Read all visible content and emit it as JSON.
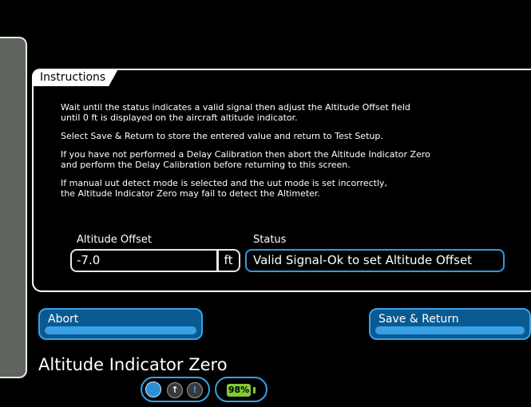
{
  "instructions": {
    "tab_label": "Instructions",
    "paragraphs": [
      "Wait until the status indicates a valid signal then adjust the Altitude Offset field\nuntil 0 ft is displayed on the aircraft altitude indicator.",
      "Select Save & Return to store the entered value and return to Test Setup.",
      "If you have not performed a Delay Calibration then abort the Altitude Indicator Zero\nand perform the Delay Calibration before returning to this screen.",
      "If manual uut detect mode is selected and the uut mode is set incorrectly,\nthe Altitude Indicator Zero may fail to detect the Altimeter."
    ]
  },
  "altitude_offset": {
    "label": "Altitude Offset",
    "value": "-7.0",
    "unit": "ft"
  },
  "status": {
    "label": "Status",
    "value": "Valid Signal-Ok to set Altitude Offset"
  },
  "buttons": {
    "abort": "Abort",
    "save_return": "Save & Return"
  },
  "screen_title": "Altitude Indicator Zero",
  "indicators": {
    "battery_percent": "98%",
    "icon1": "arrow-up-icon",
    "icon2": "exclamation-icon"
  },
  "colors": {
    "accent_blue": "#3aa0e6",
    "button_fill": "#0a5a92",
    "battery_green": "#7fcc35"
  }
}
